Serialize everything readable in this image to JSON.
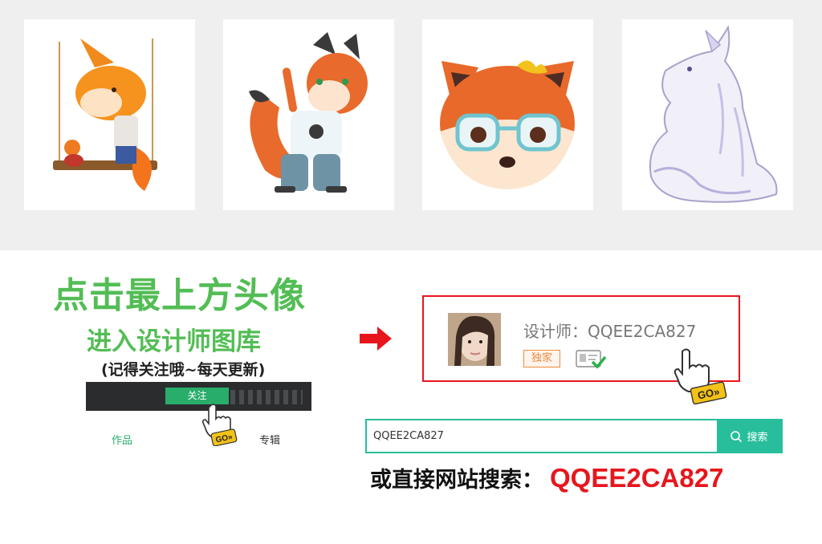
{
  "gallery": {
    "items": [
      {
        "icon": "fox-on-swing-illustration"
      },
      {
        "icon": "fox-waving-illustration"
      },
      {
        "icon": "fox-with-glasses-illustration"
      },
      {
        "icon": "white-fox-sketch-illustration"
      }
    ]
  },
  "instructions": {
    "line1": "点击最上方头像",
    "line2": "进入设计师图库",
    "line3": "(记得关注哦~每天更新)",
    "follow_button": "关注",
    "tab_works": "作品",
    "tab_album": "专辑",
    "go_label": "GO»"
  },
  "designer": {
    "name": "设计师：QQEE2CA827",
    "exclusive_badge": "独家",
    "go_label": "GO»"
  },
  "search": {
    "value": "QQEE2CA827",
    "button_label": "搜索"
  },
  "footer": {
    "label": "或直接网站搜索：",
    "code": "QQEE2CA827"
  },
  "colors": {
    "green_heading": "#53bd55",
    "follow_green": "#29ad6b",
    "search_teal": "#28be9b",
    "highlight_red": "#e7161d"
  }
}
